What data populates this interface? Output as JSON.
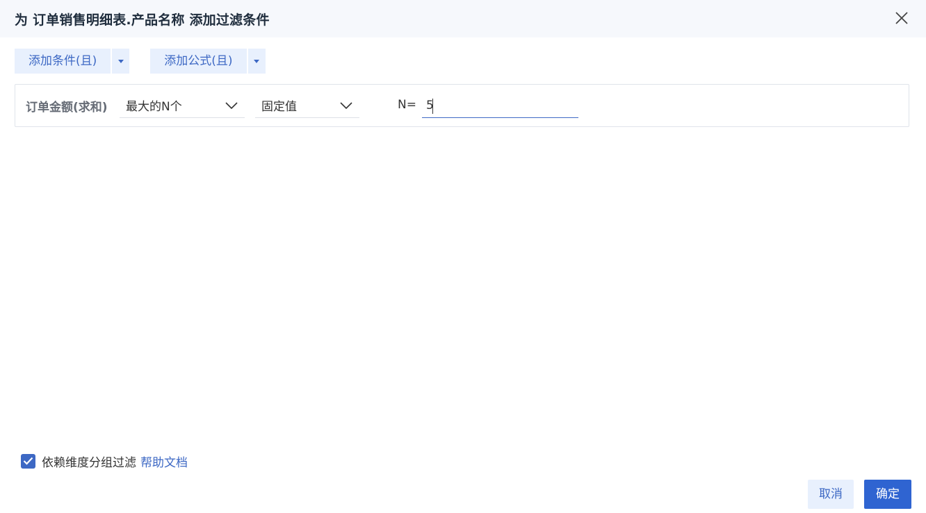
{
  "dialog": {
    "title": "为 订单销售明细表.产品名称 添加过滤条件"
  },
  "toolbar": {
    "add_condition_label": "添加条件(且)",
    "add_formula_label": "添加公式(且)"
  },
  "condition": {
    "field": "订单金额(求和)",
    "operator": "最大的N个",
    "value_type": "固定值",
    "n_label": "N=",
    "n_value": "5"
  },
  "group_filter": {
    "label": "依赖维度分组过滤",
    "checked": true,
    "help_link": "帮助文档"
  },
  "footer": {
    "cancel_label": "取消",
    "ok_label": "确定"
  },
  "colors": {
    "accent": "#2f64d1",
    "accent_light": "#e8f0fd",
    "header_bg": "#f6f8fc"
  }
}
